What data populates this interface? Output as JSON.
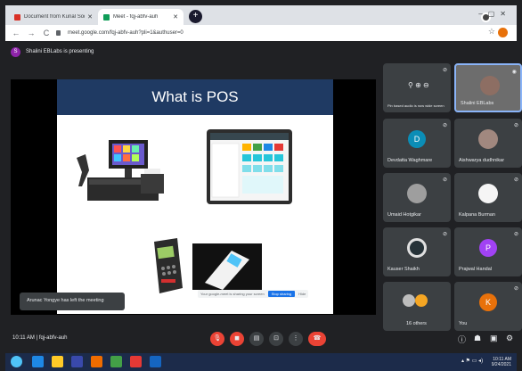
{
  "browser": {
    "tabs": [
      {
        "label": "Document from Kunal Sodhi - k",
        "favicon_color": "#d93025"
      },
      {
        "label": "Meet - fqj-abfv-auh",
        "favicon_color": "#0f9d58"
      }
    ],
    "new_tab_label": "+",
    "url": "meet.google.com/fqj-abfv-auh?pli=1&authuser=0"
  },
  "meet": {
    "presenter_initial": "S",
    "presenter_banner": "Shalini EBLabs is presenting",
    "slide_title": "What is POS",
    "left_notice": "Arunac Yongye has left the meeting",
    "share_hint_text": "Your google-meet is sharing your screen",
    "share_hint_stop": "Stop sharing",
    "share_hint_hide": "Hide",
    "meeting_time": "10:11 AM",
    "meeting_code": "fqj-abfv-auh"
  },
  "participants": [
    {
      "name": "Pin based audio is now wide screen",
      "kind": "hint"
    },
    {
      "name": "Shalini EBLabs",
      "kind": "photo"
    },
    {
      "name": "Devdatta Waghmare",
      "initial": "D",
      "color": "#0b8db6"
    },
    {
      "name": "Aishwarya dudhnikar",
      "kind": "photo"
    },
    {
      "name": "Umaid Hotgikar",
      "kind": "photo"
    },
    {
      "name": "Kalpana Burman",
      "kind": "photo"
    },
    {
      "name": "Kauser Shaikh",
      "kind": "photo"
    },
    {
      "name": "Prajwal Handal",
      "initial": "P",
      "color": "#a142f4"
    },
    {
      "name": "16 others",
      "kind": "group"
    },
    {
      "name": "You",
      "initial": "K",
      "color": "#e8710a"
    }
  ],
  "taskbar": {
    "time": "10:11 AM",
    "date": "9/24/2021"
  },
  "colors": {
    "meet_bg": "#202124",
    "tile_bg": "#3c4043",
    "hangup_red": "#ea4335"
  }
}
